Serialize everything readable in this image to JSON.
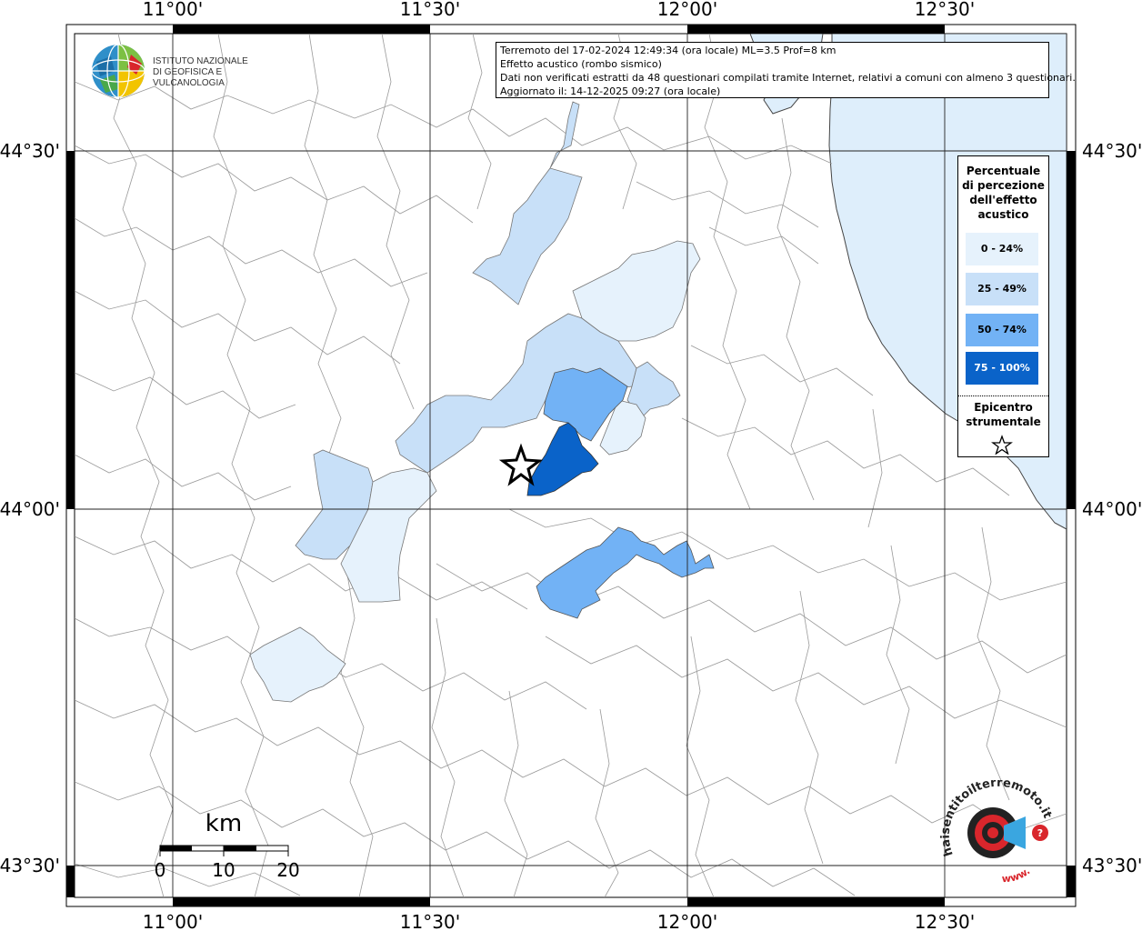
{
  "map": {
    "lon_labels": [
      "11°00'",
      "11°30'",
      "12°00'",
      "12°30'"
    ],
    "lat_labels": [
      "44°30'",
      "44°00'",
      "43°30'"
    ],
    "info_lines": [
      "Terremoto del 17-02-2024 12:49:34 (ora locale) ML=3.5 Prof=8 km",
      "Effetto acustico (rombo sismico)",
      "Dati non verificati estratti da 48 questionari compilati tramite Internet, relativi a comuni con almeno 3 questionari.",
      "Aggiornato il: 14-12-2025 09:27 (ora locale)"
    ],
    "scale": {
      "unit": "km",
      "ticks": [
        "0",
        "10",
        "20"
      ]
    },
    "colors": {
      "sea": "#deeefb",
      "class1": "#e6f2fc",
      "class2": "#c8e0f8",
      "class3": "#72b2f5",
      "class4": "#0a63c9"
    }
  },
  "legend": {
    "title_lines": [
      "Percentuale",
      "di percezione",
      "dell'effetto",
      "acustico"
    ],
    "classes": [
      "0 - 24%",
      "25 - 49%",
      "50 - 74%",
      "75 - 100%"
    ],
    "epicenter_lines": [
      "Epicentro",
      "strumentale"
    ]
  },
  "logos": {
    "ingv_lines": [
      "ISTITUTO NAZIONALE",
      "DI GEOFISICA E VULCANOLOGIA"
    ],
    "haisentito_text": "haisentitoilterremoto.it",
    "haisentito_www": "www."
  }
}
